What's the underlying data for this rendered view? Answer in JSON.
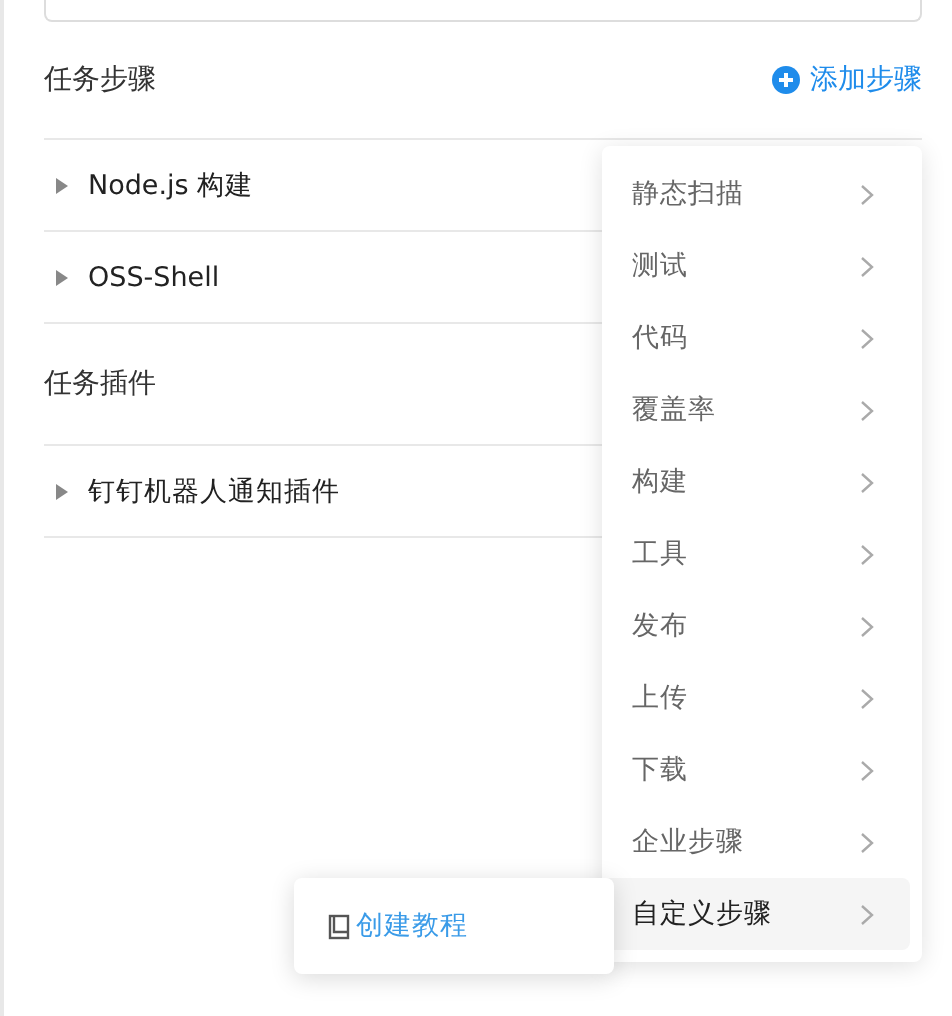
{
  "steps_section": {
    "title": "任务步骤",
    "add_button": "添加步骤"
  },
  "steps": [
    {
      "name": "Node.js 构建",
      "expanded": false
    },
    {
      "name": "OSS-Shell",
      "expanded": false
    }
  ],
  "plugins_section": {
    "title": "任务插件"
  },
  "plugins": [
    {
      "name": "钉钉机器人通知插件",
      "expanded": false
    }
  ],
  "menu": [
    {
      "label": "静态扫描",
      "selected": false
    },
    {
      "label": "测试",
      "selected": false
    },
    {
      "label": "代码",
      "selected": false
    },
    {
      "label": "覆盖率",
      "selected": false
    },
    {
      "label": "构建",
      "selected": false
    },
    {
      "label": "工具",
      "selected": false
    },
    {
      "label": "发布",
      "selected": false
    },
    {
      "label": "上传",
      "selected": false
    },
    {
      "label": "下载",
      "selected": false
    },
    {
      "label": "企业步骤",
      "selected": false
    },
    {
      "label": "自定义步骤",
      "selected": true
    }
  ],
  "submenu": [
    {
      "label": "创建教程"
    }
  ]
}
